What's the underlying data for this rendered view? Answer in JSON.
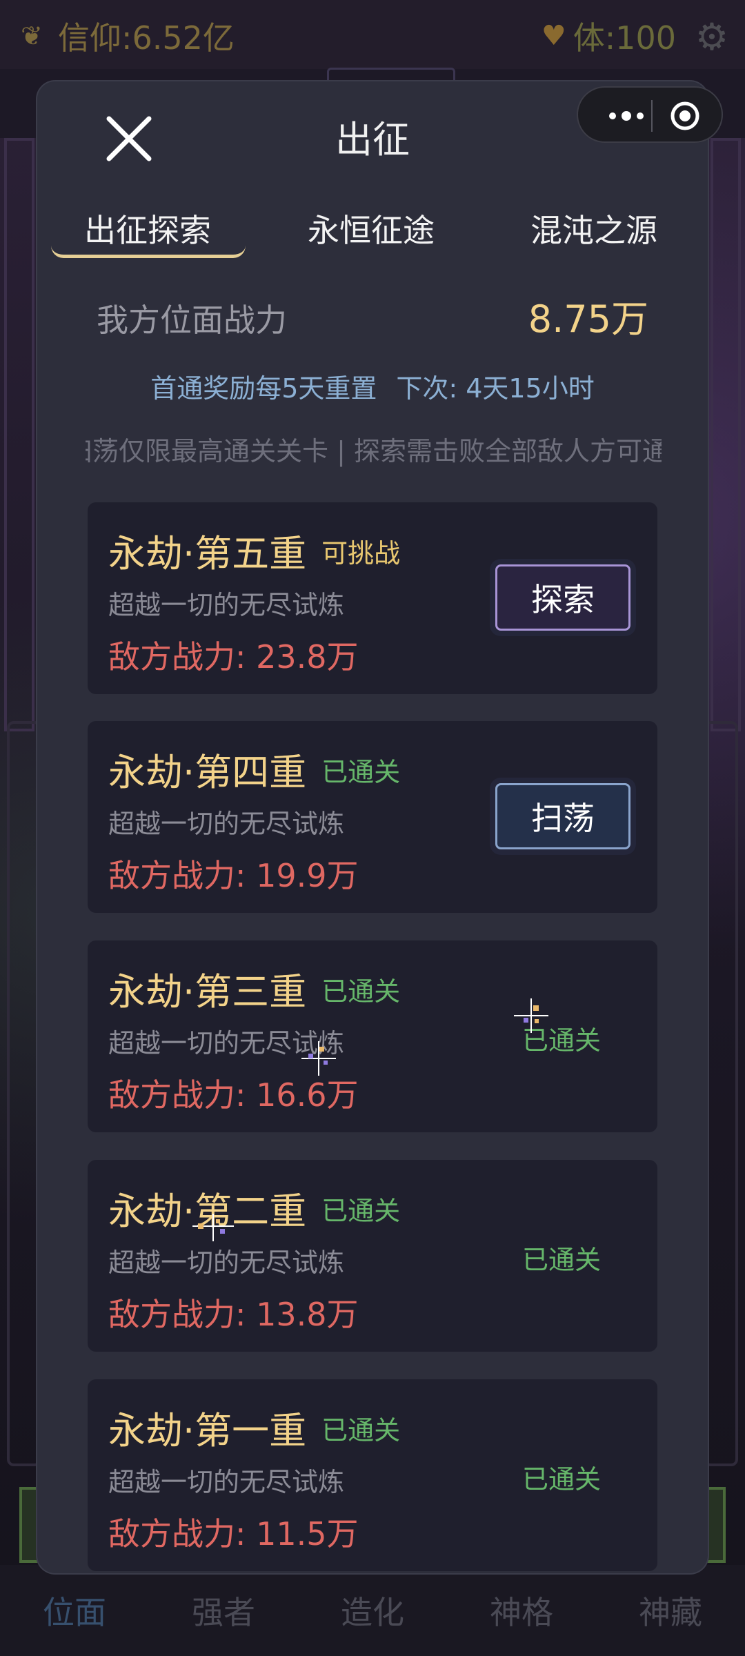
{
  "topbar": {
    "faith": "信仰:6.52亿",
    "stamina": "体:100"
  },
  "bottom_nav": [
    "位面",
    "强者",
    "造化",
    "神格",
    "神藏"
  ],
  "modal": {
    "title": "出征",
    "tabs": [
      "出征探索",
      "永恒征途",
      "混沌之源"
    ],
    "power_label": "我方位面战力",
    "power_value": "8.75万",
    "reset_text": "首通奖励每5天重置",
    "next_text": "下次: 4天15小时",
    "marquee": "扫荡仅限最高通关关卡 | 探索需击败全部敌人方可通关",
    "stages": [
      {
        "title": "永劫·第五重",
        "status": "可挑战",
        "desc": "超越一切的无尽试炼",
        "enemy_power": "敌方战力: 23.8万",
        "action": "探索"
      },
      {
        "title": "永劫·第四重",
        "status": "已通关",
        "desc": "超越一切的无尽试炼",
        "enemy_power": "敌方战力: 19.9万",
        "action": "扫荡"
      },
      {
        "title": "永劫·第三重",
        "status": "已通关",
        "desc": "超越一切的无尽试炼",
        "enemy_power": "敌方战力: 16.6万",
        "action": "已通关"
      },
      {
        "title": "永劫·第二重",
        "status": "已通关",
        "desc": "超越一切的无尽试炼",
        "enemy_power": "敌方战力: 13.8万",
        "action": "已通关"
      },
      {
        "title": "永劫·第一重",
        "status": "已通关",
        "desc": "超越一切的无尽试炼",
        "enemy_power": "敌方战力: 11.5万",
        "action": "已通关"
      }
    ]
  },
  "colors": {
    "gold": "#f3d38a",
    "enemy_red": "#e06862",
    "cleared_green": "#66b66a",
    "info_blue": "#8cb0d4",
    "modal_bg": "#2d2e3b",
    "card_bg": "#1f1f2d"
  }
}
